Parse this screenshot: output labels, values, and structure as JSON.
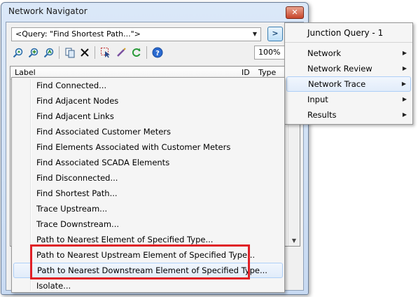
{
  "window": {
    "title": "Network Navigator",
    "close_label": "✕"
  },
  "query": {
    "selected": "<Query: \"Find Shortest Path...\">"
  },
  "zoom": {
    "value": "100%"
  },
  "grid": {
    "columns": [
      "Label",
      "ID",
      "Type"
    ]
  },
  "submenu": {
    "header": "Junction Query - 1",
    "items": [
      {
        "label": "Network"
      },
      {
        "label": "Network Review"
      },
      {
        "label": "Network Trace"
      },
      {
        "label": "Input"
      },
      {
        "label": "Results"
      }
    ],
    "highlighted": "Network Trace"
  },
  "menu": {
    "items": [
      {
        "label": "Find Connected..."
      },
      {
        "label": "Find Adjacent Nodes"
      },
      {
        "label": "Find Adjacent Links"
      },
      {
        "label": "Find Associated Customer Meters"
      },
      {
        "label": "Find Elements Associated with Customer Meters"
      },
      {
        "label": "Find Associated SCADA Elements"
      },
      {
        "label": "Find Disconnected..."
      },
      {
        "label": "Find Shortest Path..."
      },
      {
        "label": "Trace Upstream..."
      },
      {
        "label": "Trace Downstream..."
      },
      {
        "label": "Path to Nearest Element of Specified Type..."
      },
      {
        "label": "Path to Nearest Upstream Element of Specified Type..."
      },
      {
        "label": "Path to Nearest Downstream Element of Specified Type..."
      },
      {
        "label": "Isolate..."
      }
    ],
    "highlighted": "Path to Nearest Downstream Element of Specified Type...",
    "annotation_color": "#e01f26"
  },
  "toolbar_icons": [
    "select-upstream-icon",
    "zoom-in-icon",
    "zoom-to-icon",
    "copy-icon",
    "delete-icon",
    "select-in-drawing-icon",
    "highlight-icon",
    "refresh-icon",
    "help-icon"
  ]
}
